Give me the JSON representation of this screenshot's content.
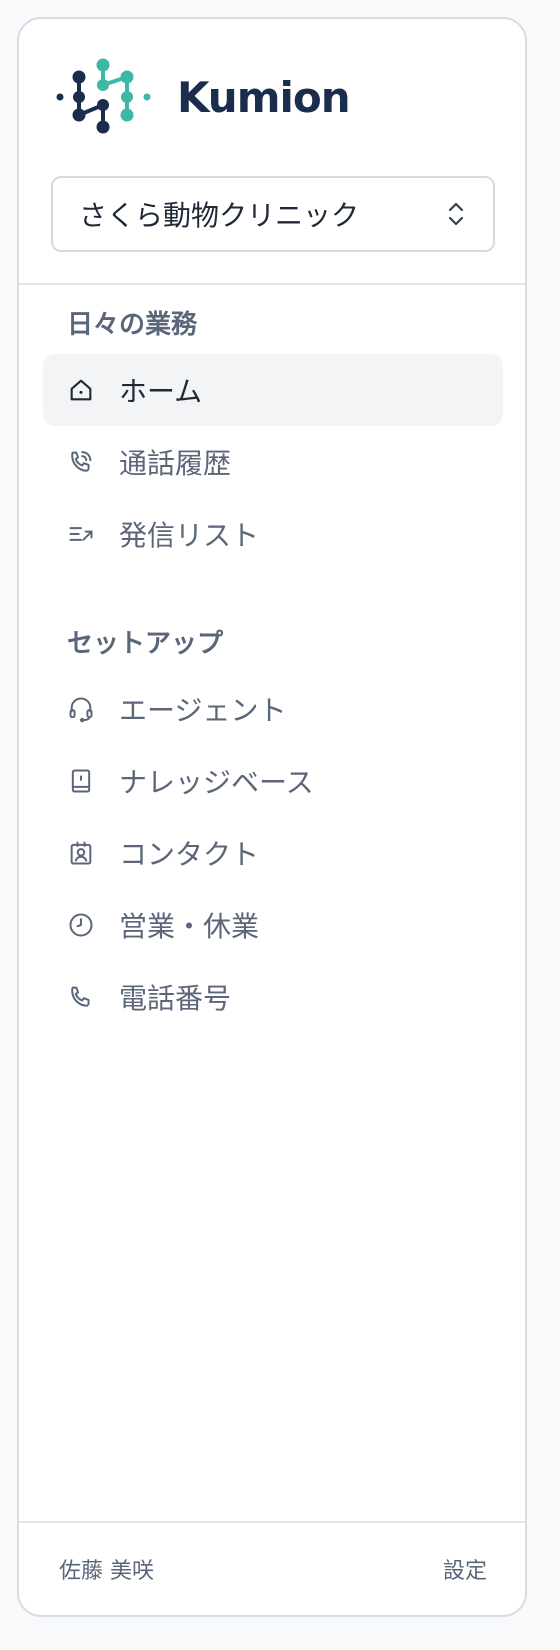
{
  "brand": {
    "name": "Kumion",
    "colors": {
      "navy": "#1b2d4c",
      "teal": "#3db8a6"
    }
  },
  "org_selector": {
    "value": "さくら動物クリニック"
  },
  "sections": [
    {
      "title": "日々の業務",
      "items": [
        {
          "label": "ホーム",
          "icon": "home-icon",
          "active": true
        },
        {
          "label": "通話履歴",
          "icon": "phone-history-icon"
        },
        {
          "label": "発信リスト",
          "icon": "outbound-list-icon"
        }
      ]
    },
    {
      "title": "セットアップ",
      "items": [
        {
          "label": "エージェント",
          "icon": "headset-icon"
        },
        {
          "label": "ナレッジベース",
          "icon": "book-icon"
        },
        {
          "label": "コンタクト",
          "icon": "contact-card-icon"
        },
        {
          "label": "営業・休業",
          "icon": "clock-icon"
        },
        {
          "label": "電話番号",
          "icon": "phone-icon"
        }
      ]
    }
  ],
  "footer": {
    "user": "佐藤 美咲",
    "settings": "設定"
  }
}
